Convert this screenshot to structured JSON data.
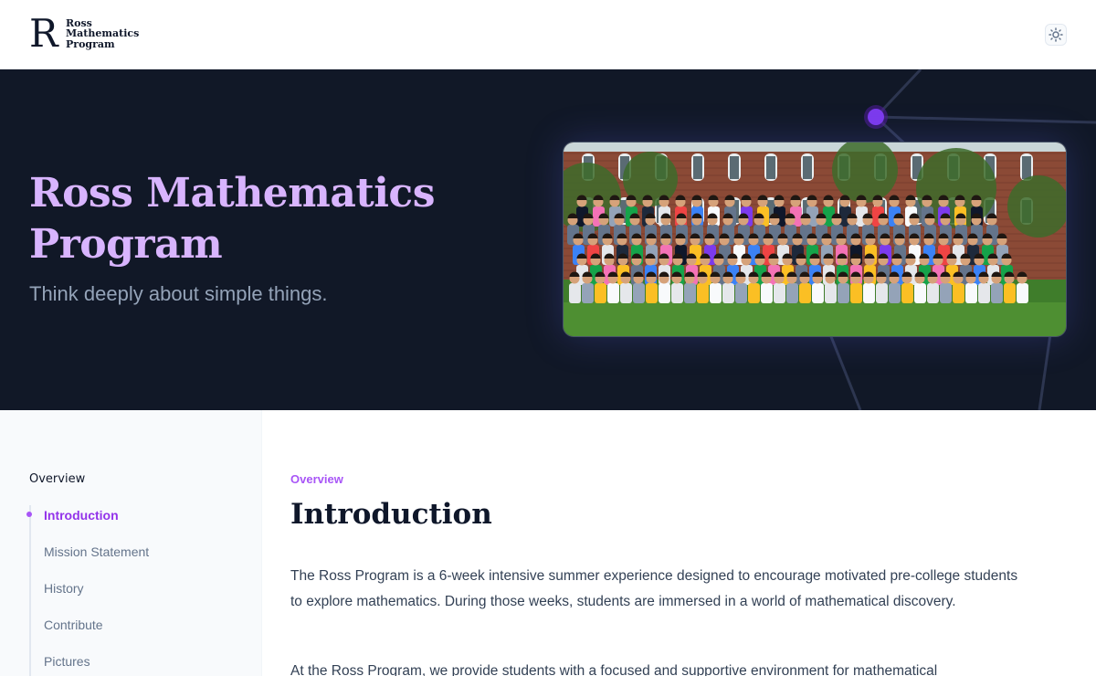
{
  "header": {
    "logo_mark": "R",
    "logo_lines": [
      "Ross",
      "Mathematics",
      "Program"
    ],
    "theme_toggle_icon": "sun-icon"
  },
  "hero": {
    "title": "Ross Mathematics Program",
    "subtitle": "Think deeply about simple things.",
    "photo_icon": "group-photo"
  },
  "sidebar": {
    "heading": "Overview",
    "items": [
      {
        "label": "Introduction",
        "active": true
      },
      {
        "label": "Mission Statement",
        "active": false
      },
      {
        "label": "History",
        "active": false
      },
      {
        "label": "Contribute",
        "active": false
      },
      {
        "label": "Pictures",
        "active": false
      }
    ]
  },
  "main": {
    "eyebrow": "Overview",
    "title": "Introduction",
    "paragraphs": [
      "The Ross Program is a 6-week intensive summer experience designed to encourage motivated pre-college students to explore mathematics. During those weeks, students are immersed in a world of mathematical discovery.",
      "At the Ross Program, we provide students with a focused and supportive environment for mathematical"
    ]
  },
  "colors": {
    "accent": "#a855f7",
    "hero_bg": "#111827",
    "hero_title": "#d8b4fe",
    "text": "#334155"
  }
}
